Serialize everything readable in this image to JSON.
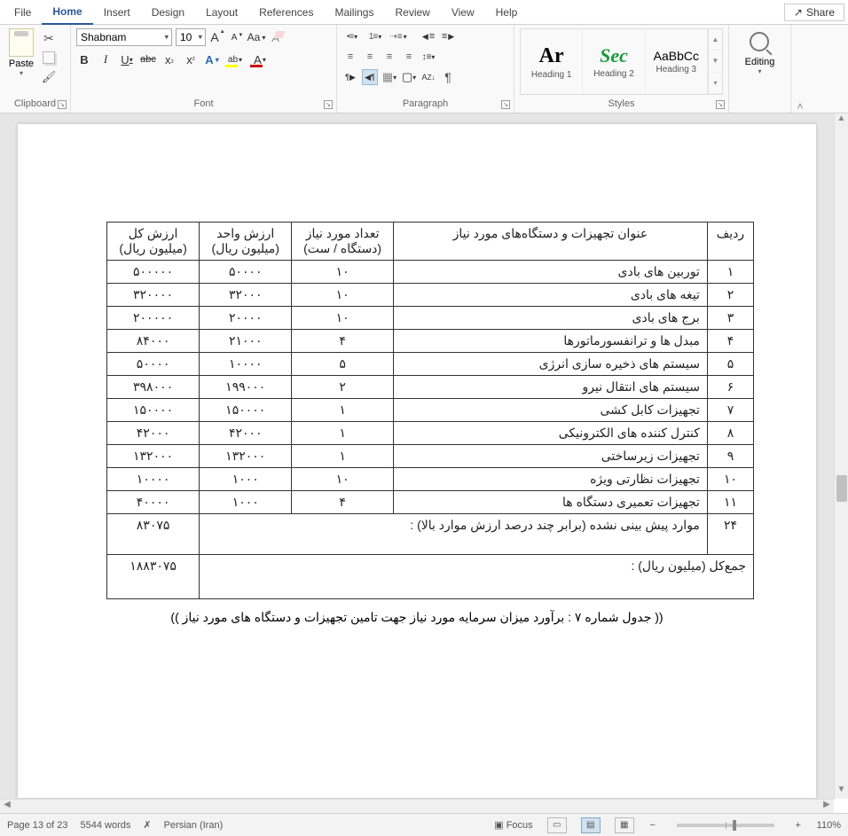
{
  "tabs": {
    "file": "File",
    "home": "Home",
    "insert": "Insert",
    "design": "Design",
    "layout": "Layout",
    "references": "References",
    "mailings": "Mailings",
    "review": "Review",
    "view": "View",
    "help": "Help"
  },
  "share": "Share",
  "ribbon_groups": {
    "clipboard": "Clipboard",
    "font": "Font",
    "paragraph": "Paragraph",
    "styles": "Styles",
    "editing": "Editing"
  },
  "clipboard": {
    "paste": "Paste"
  },
  "font": {
    "name": "Shabnam",
    "size": "10"
  },
  "styles_gallery": [
    {
      "preview": "Ar",
      "name": "Heading 1",
      "color": "#000",
      "weight": "700",
      "family": "serif"
    },
    {
      "preview": "Sec",
      "name": "Heading 2",
      "color": "#1a9a3c",
      "weight": "700",
      "style": "italic",
      "family": "serif"
    },
    {
      "preview": "AaBbCc",
      "name": "Heading 3",
      "color": "#333",
      "weight": "400"
    }
  ],
  "editing": {
    "label": "Editing"
  },
  "document": {
    "headers": {
      "row_no": "ردیف",
      "title": "عنوان تجهیزات و دستگاه‌های مورد نیاز",
      "qty": "تعداد مورد نیاز (دستگاه / ست)",
      "unit": "ارزش واحد (میلیون ریال)",
      "total": "ارزش کل (میلیون ریال)"
    },
    "rows": [
      {
        "n": "۱",
        "title": "توربین های بادی",
        "qty": "۱۰",
        "unit": "۵۰۰۰۰",
        "total": "۵۰۰۰۰۰"
      },
      {
        "n": "۲",
        "title": "تیغه های بادی",
        "qty": "۱۰",
        "unit": "۳۲۰۰۰",
        "total": "۳۲۰۰۰۰"
      },
      {
        "n": "۳",
        "title": "برج های بادی",
        "qty": "۱۰",
        "unit": "۲۰۰۰۰",
        "total": "۲۰۰۰۰۰"
      },
      {
        "n": "۴",
        "title": "مبدل ها و ترانفسورماتورها",
        "qty": "۴",
        "unit": "۲۱۰۰۰",
        "total": "۸۴۰۰۰"
      },
      {
        "n": "۵",
        "title": "سیستم های ذخیره سازی انرژی",
        "qty": "۵",
        "unit": "۱۰۰۰۰",
        "total": "۵۰۰۰۰"
      },
      {
        "n": "۶",
        "title": "سیستم های انتقال نیرو",
        "qty": "۲",
        "unit": "۱۹۹۰۰۰",
        "total": "۳۹۸۰۰۰"
      },
      {
        "n": "۷",
        "title": "تجهیزات کابل کشی",
        "qty": "۱",
        "unit": "۱۵۰۰۰۰",
        "total": "۱۵۰۰۰۰"
      },
      {
        "n": "۸",
        "title": "کنترل کننده های الکترونیکی",
        "qty": "۱",
        "unit": "۴۲۰۰۰",
        "total": "۴۲۰۰۰"
      },
      {
        "n": "۹",
        "title": "تجهیزات زیرساختی",
        "qty": "۱",
        "unit": "۱۳۲۰۰۰",
        "total": "۱۳۲۰۰۰"
      },
      {
        "n": "۱۰",
        "title": "تجهیزات نظارتی ویژه",
        "qty": "۱۰",
        "unit": "۱۰۰۰",
        "total": "۱۰۰۰۰"
      },
      {
        "n": "۱۱",
        "title": "تجهیزات تعمیری دستگاه ها",
        "qty": "۴",
        "unit": "۱۰۰۰",
        "total": "۴۰۰۰۰"
      }
    ],
    "contingency": {
      "n": "۲۴",
      "label": "موارد پیش بینی نشده (برابر چند درصد ارزش موارد بالا) :",
      "value": "۸۳۰۷۵"
    },
    "grand_total": {
      "label": "جمع‌کل (میلیون ریال) :",
      "value": "۱۸۸۳۰۷۵"
    },
    "caption": "(( جدول شماره ۷ : برآورد میزان سرمایه مورد نیاز جهت تامین تجهیزات و دستگاه های مورد نیاز ))"
  },
  "status": {
    "page": "Page 13 of 23",
    "words": "5544 words",
    "lang": "Persian (Iran)",
    "focus": "Focus",
    "zoom": "110%"
  },
  "chart_data": {
    "type": "table",
    "title": "جدول شماره ۷ : برآورد میزان سرمایه مورد نیاز جهت تامین تجهیزات و دستگاه های مورد نیاز",
    "columns": [
      "ردیف",
      "عنوان تجهیزات و دستگاه‌های مورد نیاز",
      "تعداد مورد نیاز (دستگاه / ست)",
      "ارزش واحد (میلیون ریال)",
      "ارزش کل (میلیون ریال)"
    ],
    "rows": [
      [
        1,
        "توربین های بادی",
        10,
        50000,
        500000
      ],
      [
        2,
        "تیغه های بادی",
        10,
        32000,
        320000
      ],
      [
        3,
        "برج های بادی",
        10,
        20000,
        200000
      ],
      [
        4,
        "مبدل ها و ترانفسورماتورها",
        4,
        21000,
        84000
      ],
      [
        5,
        "سیستم های ذخیره سازی انرژی",
        5,
        10000,
        50000
      ],
      [
        6,
        "سیستم های انتقال نیرو",
        2,
        199000,
        398000
      ],
      [
        7,
        "تجهیزات کابل کشی",
        1,
        150000,
        150000
      ],
      [
        8,
        "کنترل کننده های الکترونیکی",
        1,
        42000,
        42000
      ],
      [
        9,
        "تجهیزات زیرساختی",
        1,
        132000,
        132000
      ],
      [
        10,
        "تجهیزات نظارتی ویژه",
        10,
        1000,
        10000
      ],
      [
        11,
        "تجهیزات تعمیری دستگاه ها",
        4,
        1000,
        40000
      ],
      [
        24,
        "موارد پیش بینی نشده (برابر چند درصد ارزش موارد بالا)",
        null,
        null,
        83075
      ]
    ],
    "grand_total": 1883075,
    "units": "میلیون ریال"
  }
}
